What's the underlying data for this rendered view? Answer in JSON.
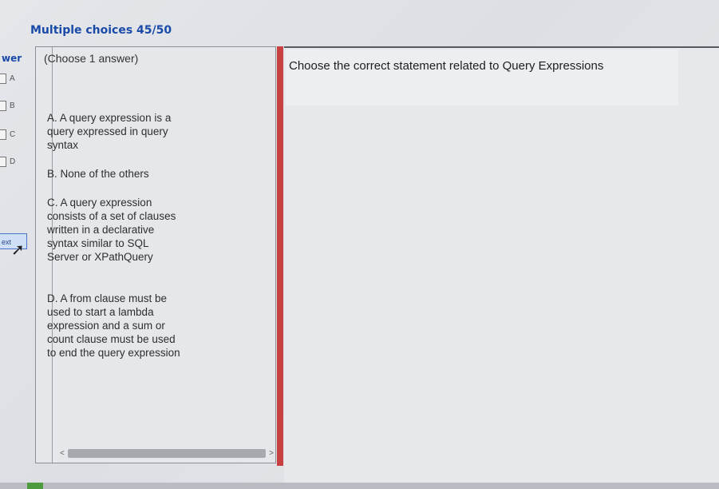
{
  "header": {
    "title": "Multiple choices 45/50"
  },
  "answer_panel": {
    "label": "wer",
    "choices": [
      "A",
      "B",
      "C",
      "D"
    ],
    "next_label": "ext"
  },
  "question_panel": {
    "hint": "(Choose 1 answer)",
    "options": [
      "A. A query expression is a query expressed in query syntax",
      "B. None of the others",
      "C. A query expression consists of a set of clauses written in a declarative syntax similar to SQL Server or XPathQuery",
      "D. A from clause must be used to start a lambda expression and a sum or count clause must be used to end the query expression"
    ],
    "scroll_left": "<",
    "scroll_right": ">"
  },
  "question": {
    "text": "Choose the correct statement related to Query Expressions"
  },
  "colors": {
    "title": "#1a4aa8",
    "splitter": "#c8403f",
    "border": "#555a61"
  }
}
